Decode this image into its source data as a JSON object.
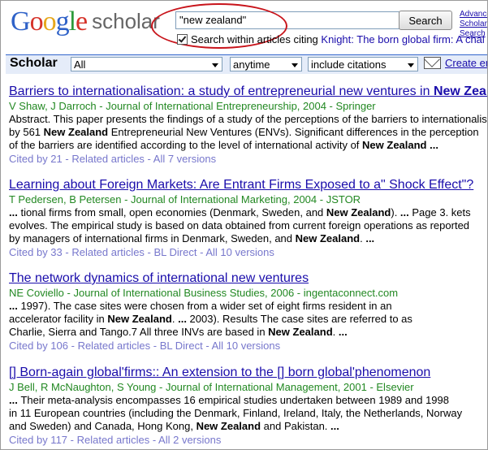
{
  "logo": {
    "google": [
      "G",
      "o",
      "o",
      "g",
      "l",
      "e"
    ],
    "scholar": "scholar"
  },
  "search": {
    "query": "\"new zealand\"",
    "button_label": "Search",
    "advanced_link": "Advanced Scholar Search"
  },
  "within": {
    "label": "Search within articles citing ",
    "link": "Knight: The born global firm: A chal"
  },
  "toolbar": {
    "section_label": "Scholar",
    "filter_all": "All",
    "filter_time": "anytime",
    "filter_citations": "include citations",
    "create_alert": "Create email alert"
  },
  "results": [
    {
      "title_pre": "Barriers to internationalisation: a study of entrepreneurial new ventures in ",
      "title_bold": "New Zealand",
      "authors": "V Shaw, J Darroch - Journal of International Entrepreneurship, 2004 - Springer",
      "snippet": [
        [
          {
            "t": "Abstract. This paper presents the findings of a study of the perceptions of the barriers to internationalisation"
          }
        ],
        [
          {
            "t": "by 561 "
          },
          {
            "t": "New Zealand",
            "b": true
          },
          {
            "t": " Entrepreneurial New Ventures (ENVs). Significant differences in the perception"
          }
        ],
        [
          {
            "t": "of the barriers are identified according to the level of international activity of "
          },
          {
            "t": "New Zealand ...",
            "b": true
          }
        ]
      ],
      "cited_by": "Cited by 21",
      "related": "Related articles",
      "versions": "All 7 versions",
      "extra": ""
    },
    {
      "title_pre": "Learning about Foreign Markets: Are Entrant Firms Exposed to a\" Shock Effect\"?",
      "title_bold": "",
      "authors": "T Pedersen, B Petersen - Journal of International Marketing, 2004 - JSTOR",
      "snippet": [
        [
          {
            "t": "... ",
            "b": true
          },
          {
            "t": "tional firms from small, open economies (Denmark, Sweden, and "
          },
          {
            "t": "New Zealand",
            "b": true
          },
          {
            "t": "). "
          },
          {
            "t": "...",
            "b": true
          },
          {
            "t": " Page 3. kets"
          }
        ],
        [
          {
            "t": "evolves. The empirical study is based on data obtained from current foreign operations as reported"
          }
        ],
        [
          {
            "t": "by managers of international firms in Denmark, Sweden, and "
          },
          {
            "t": "New Zealand",
            "b": true
          },
          {
            "t": ". "
          },
          {
            "t": "...",
            "b": true
          }
        ]
      ],
      "cited_by": "Cited by 33",
      "related": "Related articles",
      "extra": "BL Direct",
      "versions": "All 10 versions"
    },
    {
      "title_pre": "The network dynamics of international new ventures",
      "title_bold": "",
      "authors": "NE Coviello - Journal of International Business Studies, 2006 - ingentaconnect.com",
      "snippet": [
        [
          {
            "t": "... ",
            "b": true
          },
          {
            "t": "1997). The case sites were chosen from a wider set of eight firms resident in an"
          }
        ],
        [
          {
            "t": "accelerator facility in "
          },
          {
            "t": "New Zealand",
            "b": true
          },
          {
            "t": ". "
          },
          {
            "t": "...",
            "b": true
          },
          {
            "t": " 2003). Results The case sites are referred to as"
          }
        ],
        [
          {
            "t": "Charlie, Sierra and Tango.7 All three INVs are based in "
          },
          {
            "t": "New Zealand",
            "b": true
          },
          {
            "t": ". "
          },
          {
            "t": "...",
            "b": true
          }
        ]
      ],
      "cited_by": "Cited by 106",
      "related": "Related articles",
      "extra": "BL Direct",
      "versions": "All 10 versions"
    },
    {
      "title_pre": "[] Born-again global'firms:: An extension to the [] born global'phenomenon",
      "title_bold": "",
      "authors": "J Bell, R McNaughton, S Young - Journal of International Management, 2001 - Elsevier",
      "snippet": [
        [
          {
            "t": "... ",
            "b": true
          },
          {
            "t": "Their meta-analysis encompasses 16 empirical studies undertaken between 1989 and 1998"
          }
        ],
        [
          {
            "t": "in 11 European countries (including the Denmark, Finland, Ireland, Italy, the Netherlands, Norway"
          }
        ],
        [
          {
            "t": "and Sweden) and Canada, Hong Kong, "
          },
          {
            "t": "New Zealand",
            "b": true
          },
          {
            "t": " and Pakistan. "
          },
          {
            "t": "...",
            "b": true
          }
        ]
      ],
      "cited_by": "Cited by 117",
      "related": "Related articles",
      "versions": "All 2 versions",
      "extra": ""
    }
  ]
}
